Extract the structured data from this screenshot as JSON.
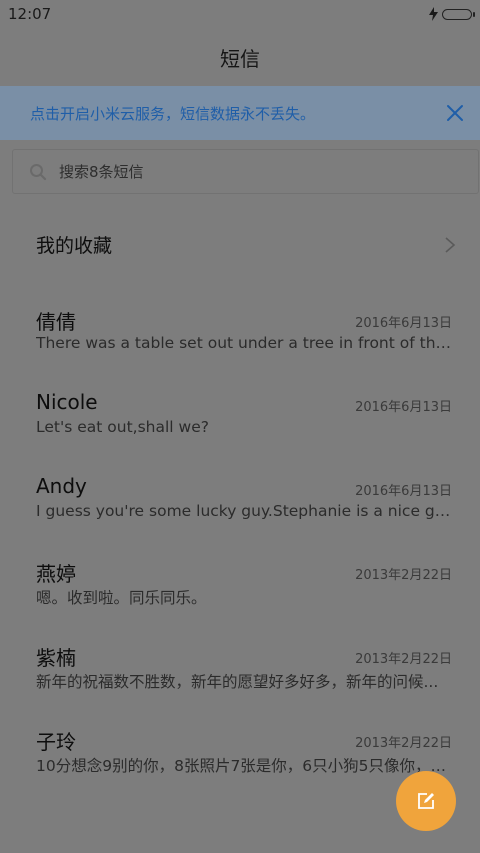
{
  "status_bar": {
    "time": "12:07"
  },
  "header": {
    "title": "短信"
  },
  "banner": {
    "text": "点击开启小米云服务，短信数据永不丢失。"
  },
  "search": {
    "placeholder": "搜索8条短信"
  },
  "favorites": {
    "label": "我的收藏"
  },
  "conversations": [
    {
      "name": "倩倩",
      "date": "2016年6月13日",
      "preview": "There was a table set out under a tree in front of the ho..."
    },
    {
      "name": "Nicole",
      "date": "2016年6月13日",
      "preview": "Let's eat out,shall we?"
    },
    {
      "name": "Andy",
      "date": "2016年6月13日",
      "preview": "I guess you're some lucky guy.Stephanie is a nice girl."
    },
    {
      "name": "燕婷",
      "date": "2013年2月22日",
      "preview": "嗯。收到啦。同乐同乐。"
    },
    {
      "name": "紫楠",
      "date": "2013年2月22日",
      "preview": "新年的祝福数不胜数，新年的愿望好多好多，新年的问候..."
    },
    {
      "name": "子玲",
      "date": "2013年2月22日",
      "preview": "10分想念9别的你，8张照片7张是你，6只小狗5只像你，4..."
    }
  ],
  "colors": {
    "accent_banner_text": "#1f5ea8",
    "fab": "#f0a43c",
    "dim_background": "#7d7d7d"
  },
  "icons": {
    "search": "search-icon",
    "close": "close-icon",
    "chevron": "chevron-right-icon",
    "compose": "compose-icon",
    "charging": "charging-icon"
  }
}
